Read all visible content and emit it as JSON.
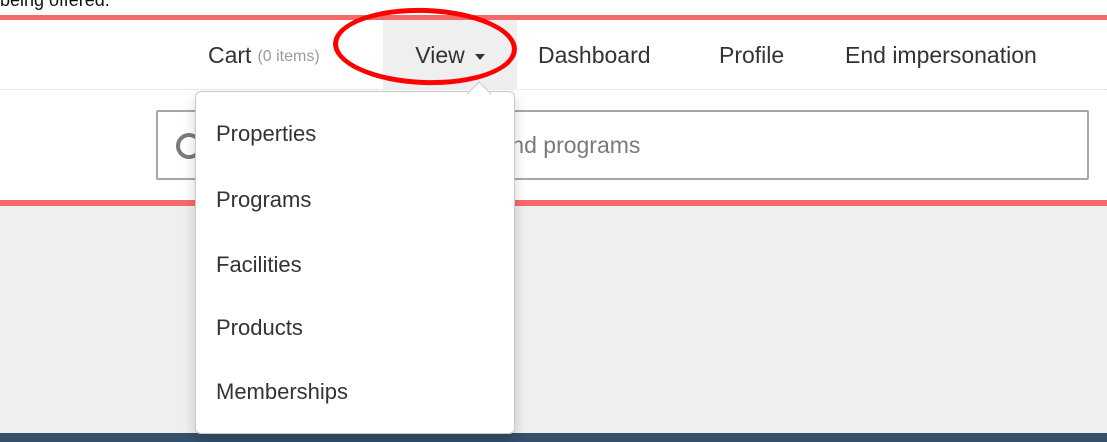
{
  "caption": {
    "visible_fragment": "being offered."
  },
  "nav": {
    "cart": {
      "label": "Cart",
      "count": "(0 items)"
    },
    "view": {
      "label": "View"
    },
    "dashboard": {
      "label": "Dashboard"
    },
    "profile": {
      "label": "Profile"
    },
    "end_impersonation": {
      "label": "End impersonation"
    }
  },
  "dropdown": {
    "items": [
      {
        "label": "Properties"
      },
      {
        "label": "Programs"
      },
      {
        "label": "Facilities"
      },
      {
        "label": "Products"
      },
      {
        "label": "Memberships"
      }
    ]
  },
  "search": {
    "placeholder": "Search properties, facilities and programs",
    "icon": "search-icon"
  },
  "annotation": {
    "type": "red-ellipse-highlight",
    "target": "View"
  },
  "colors": {
    "accent_red": "#f46a6a",
    "annotation_red": "#ff0000",
    "nav_text": "#333333",
    "muted_text": "#9b9b9b",
    "active_nav_bg": "#efefef",
    "hero_bg": "#efefef",
    "footer_blue": "#35506d"
  }
}
